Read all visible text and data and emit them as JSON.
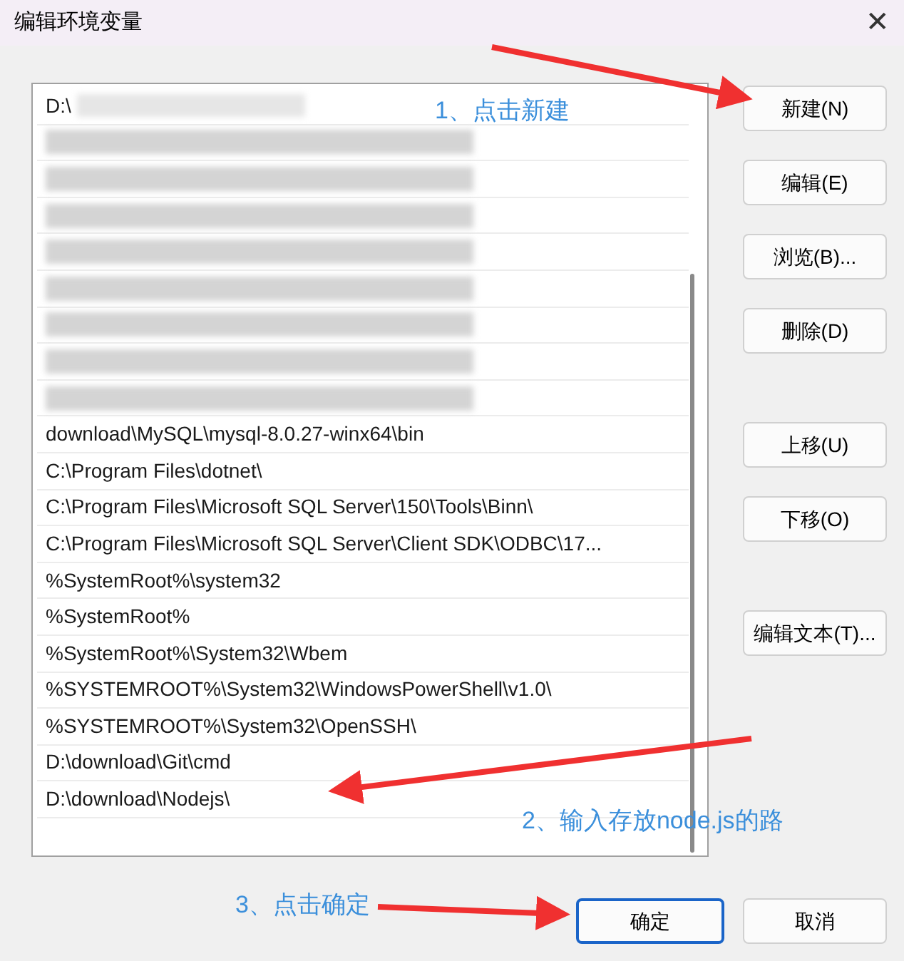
{
  "window": {
    "title": "编辑环境变量",
    "close": "✕"
  },
  "paths": [
    {
      "kind": "partial",
      "text": "D:\\"
    },
    {
      "kind": "redacted"
    },
    {
      "kind": "redacted"
    },
    {
      "kind": "redacted"
    },
    {
      "kind": "redacted"
    },
    {
      "kind": "redacted"
    },
    {
      "kind": "redacted"
    },
    {
      "kind": "redacted"
    },
    {
      "kind": "redacted"
    },
    {
      "kind": "text",
      "text": "download\\MySQL\\mysql-8.0.27-winx64\\bin"
    },
    {
      "kind": "text",
      "text": "C:\\Program Files\\dotnet\\"
    },
    {
      "kind": "text",
      "text": "C:\\Program Files\\Microsoft SQL Server\\150\\Tools\\Binn\\"
    },
    {
      "kind": "text",
      "text": "C:\\Program Files\\Microsoft SQL Server\\Client SDK\\ODBC\\17..."
    },
    {
      "kind": "text",
      "text": "%SystemRoot%\\system32"
    },
    {
      "kind": "text",
      "text": "%SystemRoot%"
    },
    {
      "kind": "text",
      "text": "%SystemRoot%\\System32\\Wbem"
    },
    {
      "kind": "text",
      "text": "%SYSTEMROOT%\\System32\\WindowsPowerShell\\v1.0\\"
    },
    {
      "kind": "text",
      "text": "%SYSTEMROOT%\\System32\\OpenSSH\\"
    },
    {
      "kind": "text",
      "text": "D:\\download\\Git\\cmd"
    },
    {
      "kind": "text",
      "text": "D:\\download\\Nodejs\\"
    }
  ],
  "side_button_groups": [
    [
      "新建(N)",
      "编辑(E)",
      "浏览(B)...",
      "删除(D)"
    ],
    [
      "上移(U)",
      "下移(O)"
    ],
    [
      "编辑文本(T)..."
    ]
  ],
  "footer_buttons": [
    {
      "label": "确定",
      "default": true
    },
    {
      "label": "取消",
      "default": false
    }
  ],
  "annotations": [
    {
      "text": "1、点击新建"
    },
    {
      "text": "2、输入存放node.js的路"
    },
    {
      "text": "3、点击确定"
    }
  ]
}
